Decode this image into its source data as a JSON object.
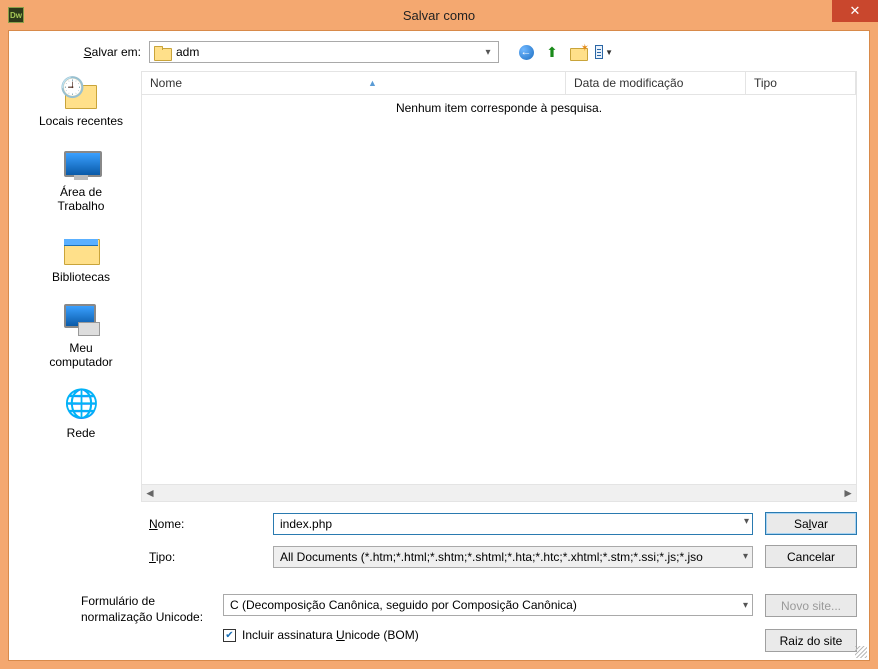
{
  "window": {
    "title": "Salvar como"
  },
  "savein": {
    "label_pre": "S",
    "label_rest": "alvar em:",
    "folder": "adm"
  },
  "columns": {
    "name": "Nome",
    "date": "Data de modificação",
    "type": "Tipo"
  },
  "list": {
    "empty": "Nenhum item corresponde à pesquisa."
  },
  "places": {
    "recent": "Locais recentes",
    "desktop_l1": "Área de",
    "desktop_l2": "Trabalho",
    "libraries": "Bibliotecas",
    "computer_l1": "Meu",
    "computer_l2": "computador",
    "network": "Rede"
  },
  "form": {
    "name_label_u": "N",
    "name_label_rest": "ome:",
    "name_value": "index.php",
    "type_label_u": "T",
    "type_label_rest": "ipo:",
    "type_value": "All Documents (*.htm;*.html;*.shtm;*.shtml;*.hta;*.htc;*.xhtml;*.stm;*.ssi;*.js;*.jso"
  },
  "buttons": {
    "save_pre": "Sa",
    "save_u": "l",
    "save_post": "var",
    "cancel": "Cancelar",
    "newsite": "Novo site...",
    "siteroot": "Raiz do site"
  },
  "unicode": {
    "label": "Formulário de normalização Unicode:",
    "value": "C (Decomposição Canônica, seguido por Composição Canônica)",
    "bom_pre": "Incluir assinatura ",
    "bom_u": "U",
    "bom_post": "nicode (BOM)"
  }
}
